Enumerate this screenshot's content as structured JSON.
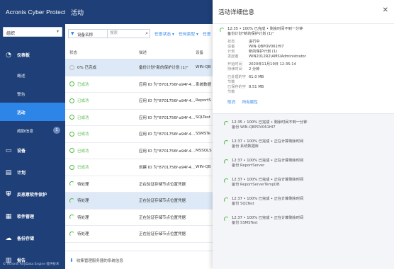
{
  "app": {
    "brand": "Acronis Cyber Protect",
    "footer": "© Acronis AnyData Engine 提供技术"
  },
  "org_selector": {
    "label": "组织"
  },
  "sidebar": {
    "items": [
      {
        "label": "仪表板",
        "icon": "dashboard-icon"
      },
      {
        "label": "概述",
        "sub": true
      },
      {
        "label": "警告",
        "sub": true
      },
      {
        "label": "活动",
        "sub": true,
        "active": true
      },
      {
        "label": "威胁信息",
        "sub": true,
        "badge": "1"
      },
      {
        "label": "设备",
        "icon": "devices-icon"
      },
      {
        "label": "计划",
        "icon": "plans-icon"
      },
      {
        "label": "反恶意软件保护",
        "icon": "antimalware-icon"
      },
      {
        "label": "软件管理",
        "icon": "software-icon"
      },
      {
        "label": "备份存储",
        "icon": "backup-storage-icon"
      },
      {
        "label": "报告",
        "icon": "reports-icon"
      }
    ]
  },
  "page": {
    "title": "活动"
  },
  "toolbar": {
    "filter_select": "设备名称",
    "search_placeholder": "搜索",
    "links": [
      "任意状态 ▾",
      "任何类型 ▾",
      "任意"
    ]
  },
  "table": {
    "headers": [
      "状态",
      "描述",
      "设备"
    ],
    "rows": [
      {
        "status": "0% 已完成",
        "kind": "progress",
        "desc": "备份计划\"新的保护计划 (1)\"",
        "device": "WIN-QB",
        "selected": true
      },
      {
        "status": "已成功",
        "kind": "ok",
        "desc": "应用 ID 为\"8701756f-a94f-4...",
        "device": "系统数据"
      },
      {
        "status": "已成功",
        "kind": "ok",
        "desc": "应用 ID 为\"8701756f-a94f-4...",
        "device": "ReportS"
      },
      {
        "status": "已成功",
        "kind": "ok",
        "desc": "应用 ID 为\"8701756f-a94f-4...",
        "device": "SQLTest"
      },
      {
        "status": "已成功",
        "kind": "ok",
        "desc": "应用 ID 为\"8701756f-a94f-4...",
        "device": "SSMSTe"
      },
      {
        "status": "已成功",
        "kind": "ok",
        "desc": "应用 ID 为\"8701756f-a94f-4...",
        "device": "MSSQLS"
      },
      {
        "status": "已成功",
        "kind": "ok",
        "desc": "创建 ID 为\"8701756f-a94f-4...",
        "device": "WIN-QB"
      },
      {
        "status": "待处理",
        "kind": "pending",
        "desc": "正在验证存储节点位置凭据",
        "device": ""
      },
      {
        "status": "待处理",
        "kind": "pending",
        "desc": "正在验证存储节点位置凭据",
        "device": "",
        "selected": true
      },
      {
        "status": "待处理",
        "kind": "pending",
        "desc": "正在验证存储节点位置凭据",
        "device": ""
      },
      {
        "status": "待处理",
        "kind": "pending",
        "desc": "正在验证存储节点位置凭据",
        "device": ""
      }
    ]
  },
  "main_footer": "收集管理服务器的系统信息",
  "panel": {
    "title": "活动详细信息",
    "summary_line1": "12:35 • 100% 已完成 • 剩余时间不到一分钟",
    "summary_line2": "备份计划\"新的保护计划 (1)\"",
    "fields": [
      {
        "k": "状态",
        "v": "进行中"
      },
      {
        "k": "设备",
        "v": "WIN-QBPOV061HI7"
      },
      {
        "k": "计划",
        "v": "新的保护计划 (1)"
      },
      {
        "k": "发起者",
        "v": "WIN2012R2\\AMS\\Administrator"
      }
    ],
    "times": [
      {
        "k": "开始时间",
        "v": "2020年11月19日 12:35:14"
      },
      {
        "k": "持续时间",
        "v": "2 分钟"
      }
    ],
    "sizes": [
      {
        "k": "已处理的字节数",
        "v": "61.0 MB"
      },
      {
        "k": "已保存的字节数",
        "v": "8.51 MB"
      }
    ],
    "links": [
      "取消",
      "所有属性"
    ],
    "sub_activities": [
      {
        "line1": "12:35 • 100% 已完成 • 剩余时间不到一分钟",
        "line2": "备份 WIN-QBPOV061HI7"
      },
      {
        "line1": "12:37 • 100% 已完成 • 正在计算剩余时间",
        "line2": "备份 系统数据库"
      },
      {
        "line1": "12:37 • 100% 已完成 • 正在计算剩余时间",
        "line2": "备份 ReportServer"
      },
      {
        "line1": "12:37 • 100% 已完成 • 正在计算剩余时间",
        "line2": "备份 ReportServerTempDB"
      },
      {
        "line1": "12:37 • 100% 已完成 • 正在计算剩余时间",
        "line2": "备份 SQLTest"
      },
      {
        "line1": "12:37 • 100% 已完成 • 正在计算剩余时间",
        "line2": "备份 SSMSTest"
      }
    ]
  }
}
